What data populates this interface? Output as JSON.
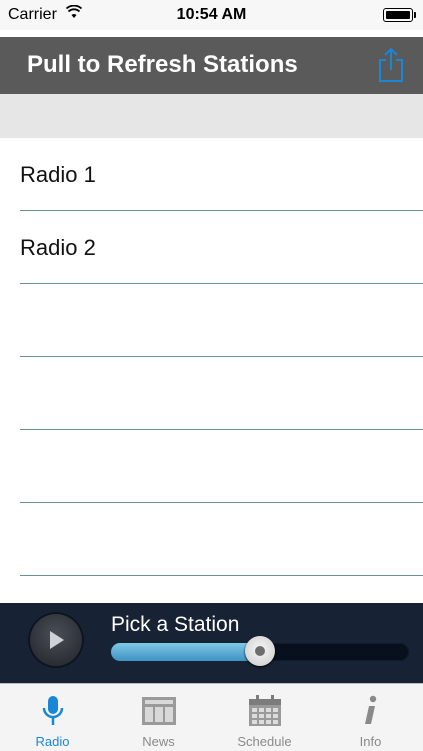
{
  "status_bar": {
    "carrier": "Carrier",
    "time": "10:54 AM"
  },
  "nav": {
    "title": "Pull to Refresh Stations",
    "share_icon": "share-icon"
  },
  "stations": [
    {
      "label": "Radio 1"
    },
    {
      "label": "Radio 2"
    },
    {
      "label": ""
    },
    {
      "label": ""
    },
    {
      "label": ""
    },
    {
      "label": ""
    }
  ],
  "player": {
    "caption": "Pick a Station",
    "progress": 0.5,
    "play_icon": "play-icon"
  },
  "tabs": [
    {
      "label": "Radio",
      "icon": "microphone-icon",
      "active": true
    },
    {
      "label": "News",
      "icon": "newspaper-icon",
      "active": false
    },
    {
      "label": "Schedule",
      "icon": "calendar-icon",
      "active": false
    },
    {
      "label": "Info",
      "icon": "info-icon",
      "active": false
    }
  ],
  "colors": {
    "accent": "#1a86d6",
    "nav_bg": "#5a5a5a",
    "player_bg": "#172335",
    "divider": "#6a8f98"
  }
}
